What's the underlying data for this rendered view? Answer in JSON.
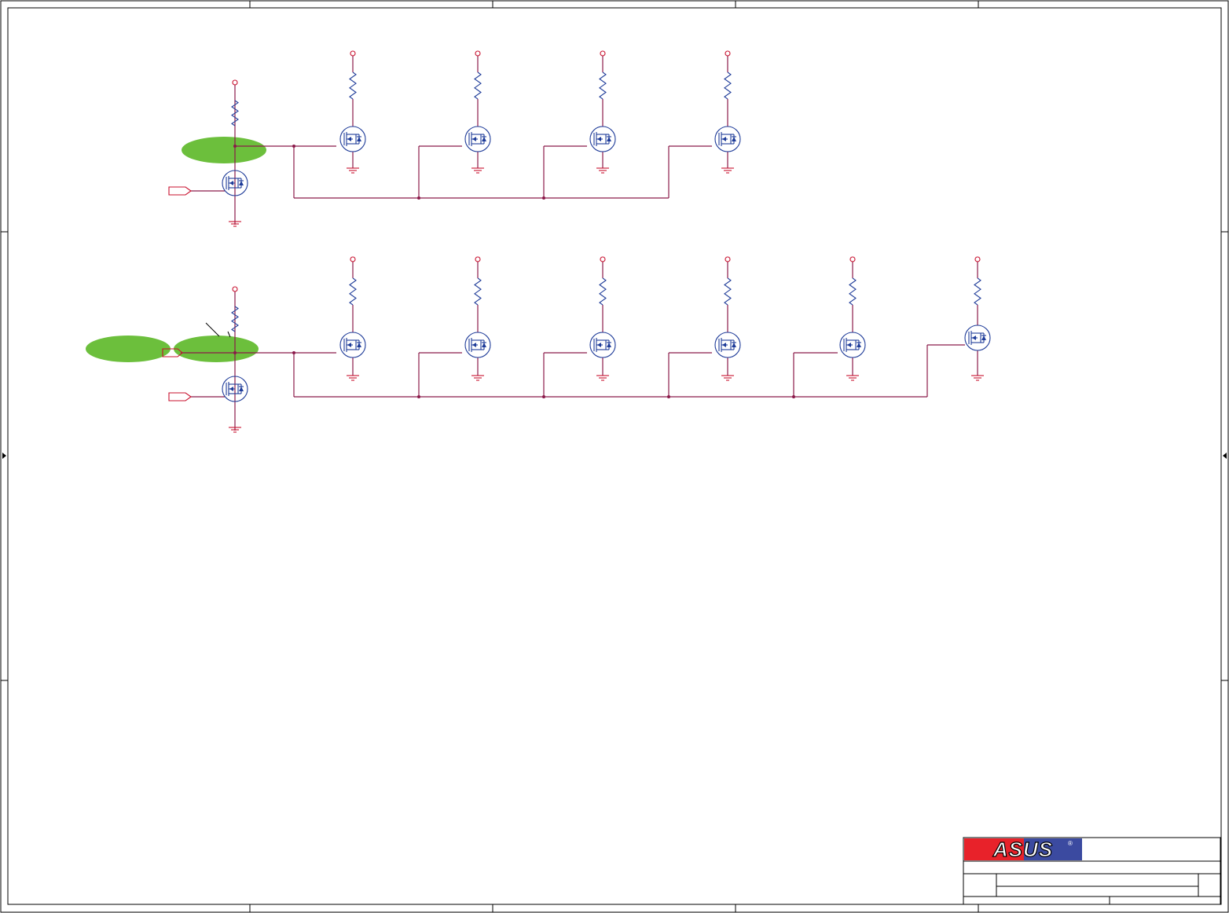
{
  "colors": {
    "wire": "#8b1a4a",
    "power": "#c8102e",
    "component": "#1f3c99",
    "highlight": "#6cbf3c",
    "logo_red": "#e8222a",
    "logo_blue": "#3b4aa0"
  },
  "title_block": {
    "logo_text": "ASUS",
    "registered_mark": "®"
  },
  "highlights": [
    {
      "name": "upper-net-highlight"
    },
    {
      "name": "lower-left-highlight"
    },
    {
      "name": "lower-net-highlight"
    }
  ]
}
